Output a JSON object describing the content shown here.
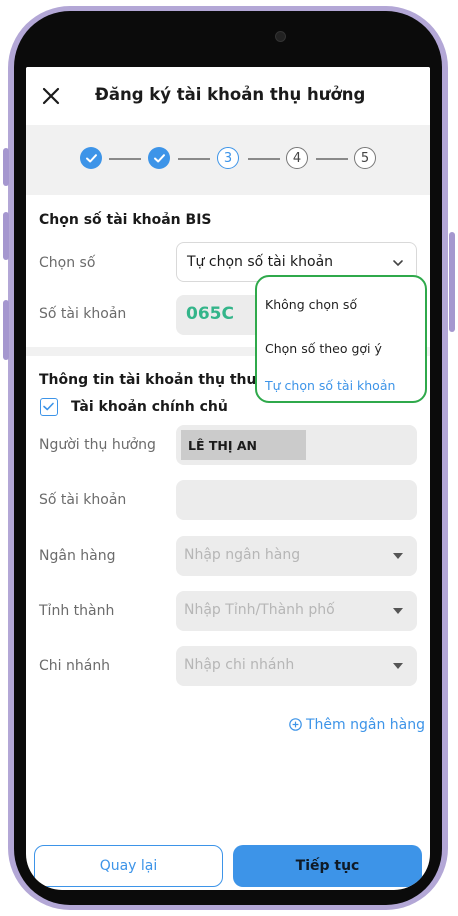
{
  "header": {
    "title": "Đăng ký tài khoản thụ hưởng"
  },
  "stepper": {
    "steps": [
      "1",
      "2",
      "3",
      "4",
      "5"
    ],
    "current_step": 3
  },
  "bis_section": {
    "title": "Chọn số tài khoản BIS",
    "choose_label": "Chọn số",
    "choose_value": "Tự chọn số tài khoản",
    "account_label": "Số tài khoản",
    "account_value": "065C"
  },
  "dropdown": {
    "options": [
      "Không chọn số",
      "Chọn số theo gợi ý",
      "Tự chọn số tài khoản"
    ],
    "selected": "Tự chọn số tài khoản"
  },
  "beneficiary_section": {
    "title": "Thông tin tài khoản thụ thưởng",
    "checkbox_label": "Tài khoản chính chủ",
    "checkbox_checked": true,
    "beneficiary_label": "Người thụ hưởng",
    "beneficiary_value": "LÊ THỊ AN",
    "account_label": "Số tài khoản",
    "bank_label": "Ngân hàng",
    "bank_placeholder": "Nhập ngân hàng",
    "province_label": "Tỉnh thành",
    "province_placeholder": "Nhập Tỉnh/Thành phố",
    "branch_label": "Chi nhánh",
    "branch_placeholder": "Nhập chi nhánh",
    "add_bank": "Thêm ngân hàng"
  },
  "footer": {
    "back_label": "Quay lại",
    "next_label": "Tiếp tục"
  },
  "colors": {
    "accent": "#3d94e8",
    "dropdown_border": "#2fa94b",
    "account_number": "#34b58a"
  }
}
